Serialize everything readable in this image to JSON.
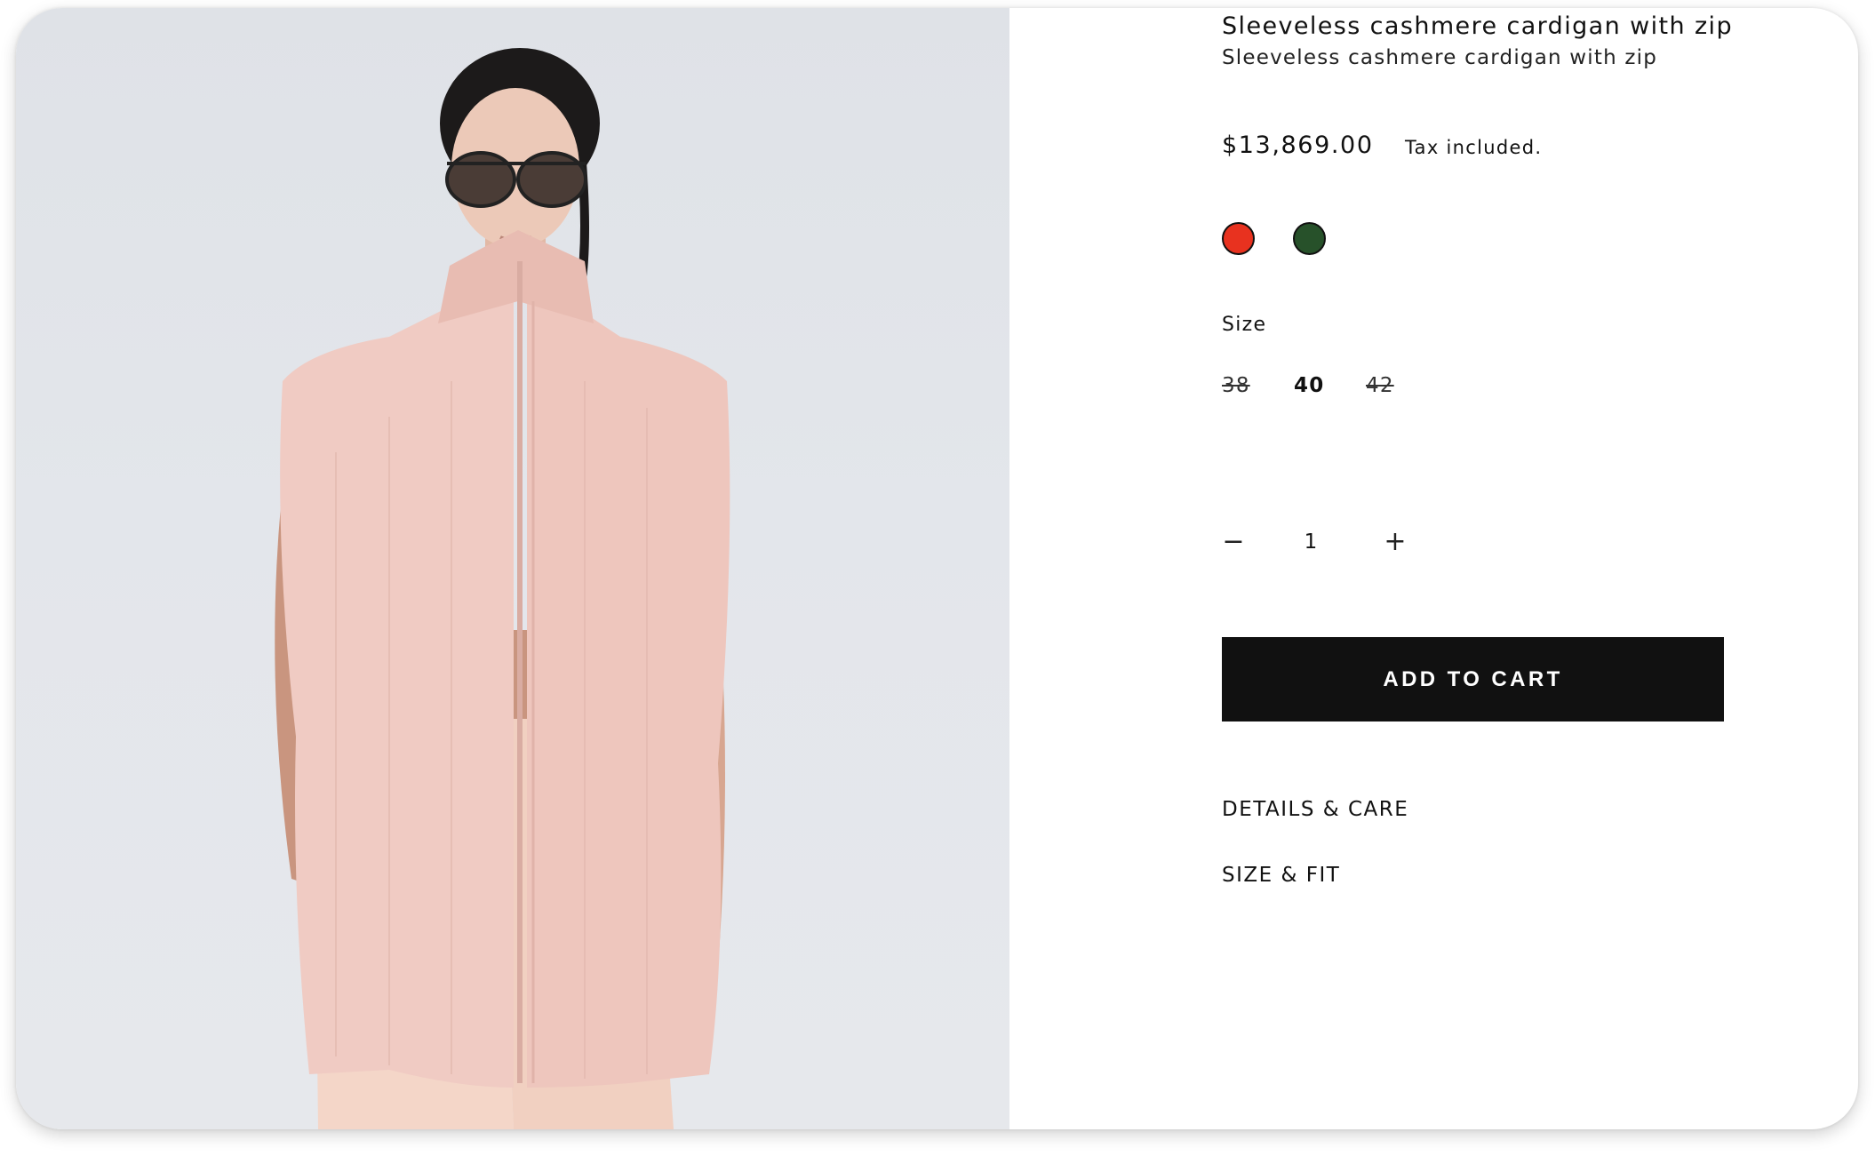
{
  "product": {
    "title": "Sleeveless cashmere cardigan with zip",
    "subtitle": "Sleeveless cashmere cardigan with zip",
    "price": "$13,869.00",
    "tax_note": "Tax included.",
    "image_alt": "model-wearing-pink-cardigan"
  },
  "colors": [
    {
      "name": "red",
      "hex": "#e8321f"
    },
    {
      "name": "green",
      "hex": "#27512a"
    }
  ],
  "size": {
    "label": "Size",
    "options": [
      {
        "label": "38",
        "available": false,
        "selected": false
      },
      {
        "label": "40",
        "available": true,
        "selected": true
      },
      {
        "label": "42",
        "available": false,
        "selected": false
      }
    ]
  },
  "quantity": {
    "decrement_icon": "minus-icon",
    "value": "1",
    "increment_icon": "plus-icon"
  },
  "cart": {
    "label": "ADD TO CART",
    "button_color": "#111111"
  },
  "accordions": [
    {
      "label": "DETAILS & CARE"
    },
    {
      "label": "SIZE & FIT"
    }
  ]
}
